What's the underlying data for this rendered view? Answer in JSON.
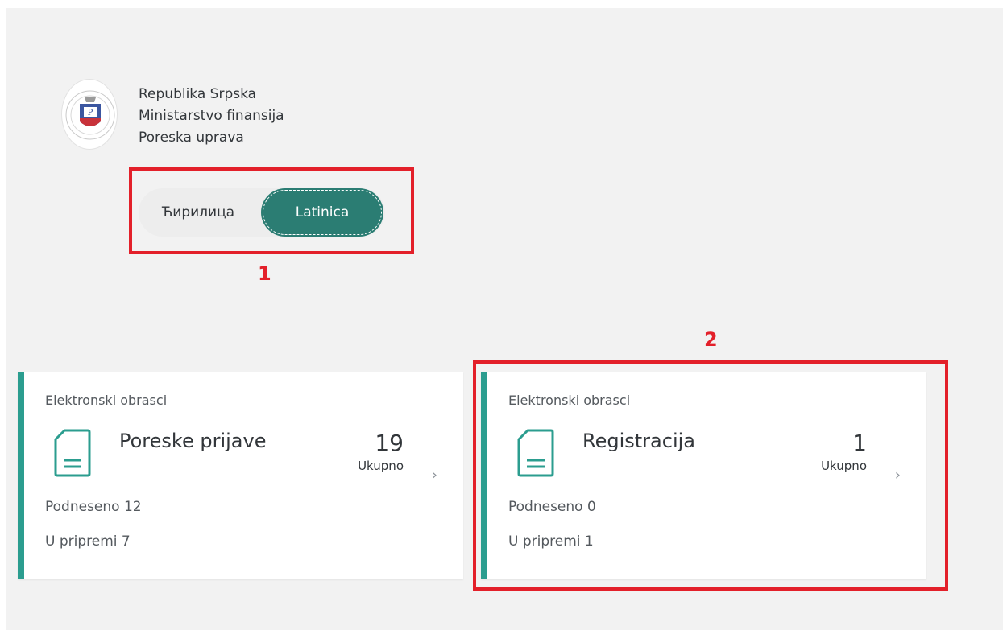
{
  "header": {
    "org_line1": "Republika Srpska",
    "org_line2": "Ministarstvo finansija",
    "org_line3": "Poreska uprava"
  },
  "language_toggle": {
    "options": [
      "Ћирилица",
      "Latinica"
    ],
    "selected": "Latinica"
  },
  "annotations": {
    "label1": "1",
    "label2": "2",
    "color": "#e3202a"
  },
  "tiles": [
    {
      "subtitle": "Elektronski obrasci",
      "title": "Poreske prijave",
      "count": "19",
      "count_label": "Ukupno",
      "stat_submitted": "Podneseno 12",
      "stat_in_progress": "U pripremi 7",
      "icon": "document-icon"
    },
    {
      "subtitle": "Elektronski obrasci",
      "title": "Registracija",
      "count": "1",
      "count_label": "Ukupno",
      "stat_submitted": "Podneseno 0",
      "stat_in_progress": "U pripremi 1",
      "icon": "document-icon"
    }
  ],
  "colors": {
    "accent": "#2b7d73",
    "tile_border": "#2b9d8f",
    "background": "#f2f2f2"
  }
}
